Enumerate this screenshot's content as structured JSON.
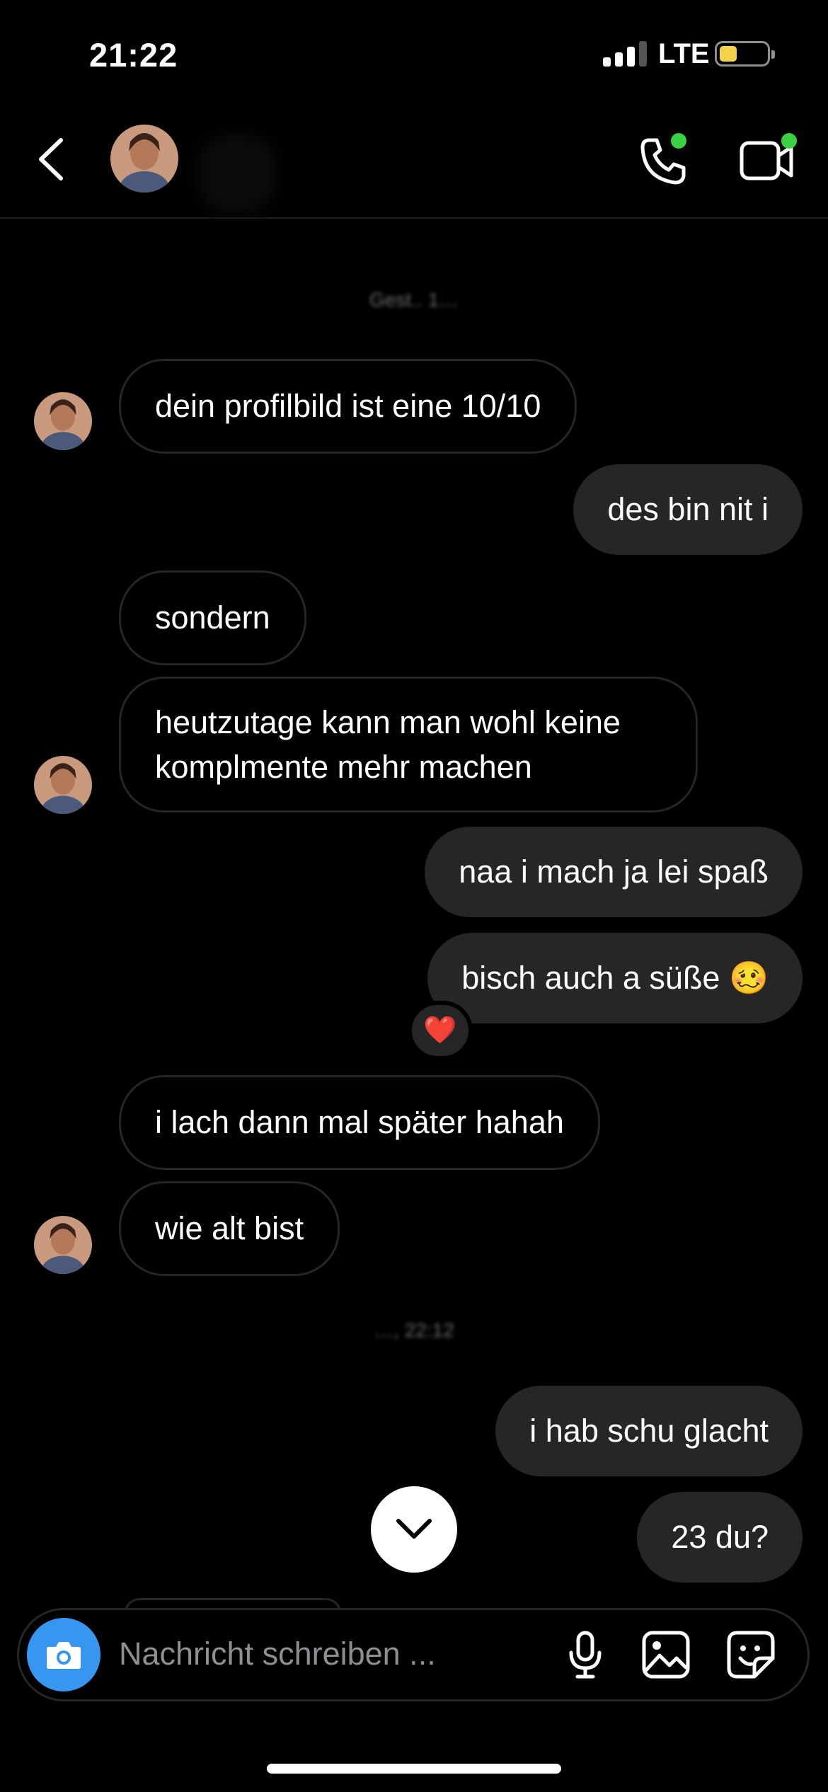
{
  "status_bar": {
    "time": "21:22",
    "network": "LTE",
    "battery_level": 0.3
  },
  "header": {
    "back_icon": "chevron-left-icon",
    "call_icon": "phone-icon",
    "video_icon": "video-camera-icon",
    "active_dot_color": "#3ad144"
  },
  "timestamps": [
    {
      "text": "Gest.. 1…"
    },
    {
      "text": "…, 22:12"
    }
  ],
  "messages": [
    {
      "text": "dein profilbild ist eine 10/10",
      "from": "them"
    },
    {
      "text": "des bin nit i",
      "from": "me"
    },
    {
      "text": "sondern",
      "from": "them"
    },
    {
      "text": "heutzutage kann man wohl keine komplmente mehr machen",
      "from": "them"
    },
    {
      "text": "naa i mach ja lei spaß",
      "from": "me"
    },
    {
      "text": "bisch auch a süße 🥴",
      "from": "me"
    },
    {
      "text": "i lach dann mal später hahah",
      "from": "them"
    },
    {
      "text": "wie alt bist",
      "from": "them"
    },
    {
      "text": "i hab schu glacht",
      "from": "me"
    },
    {
      "text": "23 du?",
      "from": "me"
    }
  ],
  "reaction": {
    "emoji": "❤️"
  },
  "composer": {
    "placeholder": "Nachricht schreiben ...",
    "camera_icon": "camera-icon",
    "mic_icon": "microphone-icon",
    "gallery_icon": "image-icon",
    "sticker_icon": "sticker-icon"
  },
  "colors": {
    "background": "#000000",
    "bubble_out": "#262626",
    "accent": "#3797f0"
  }
}
